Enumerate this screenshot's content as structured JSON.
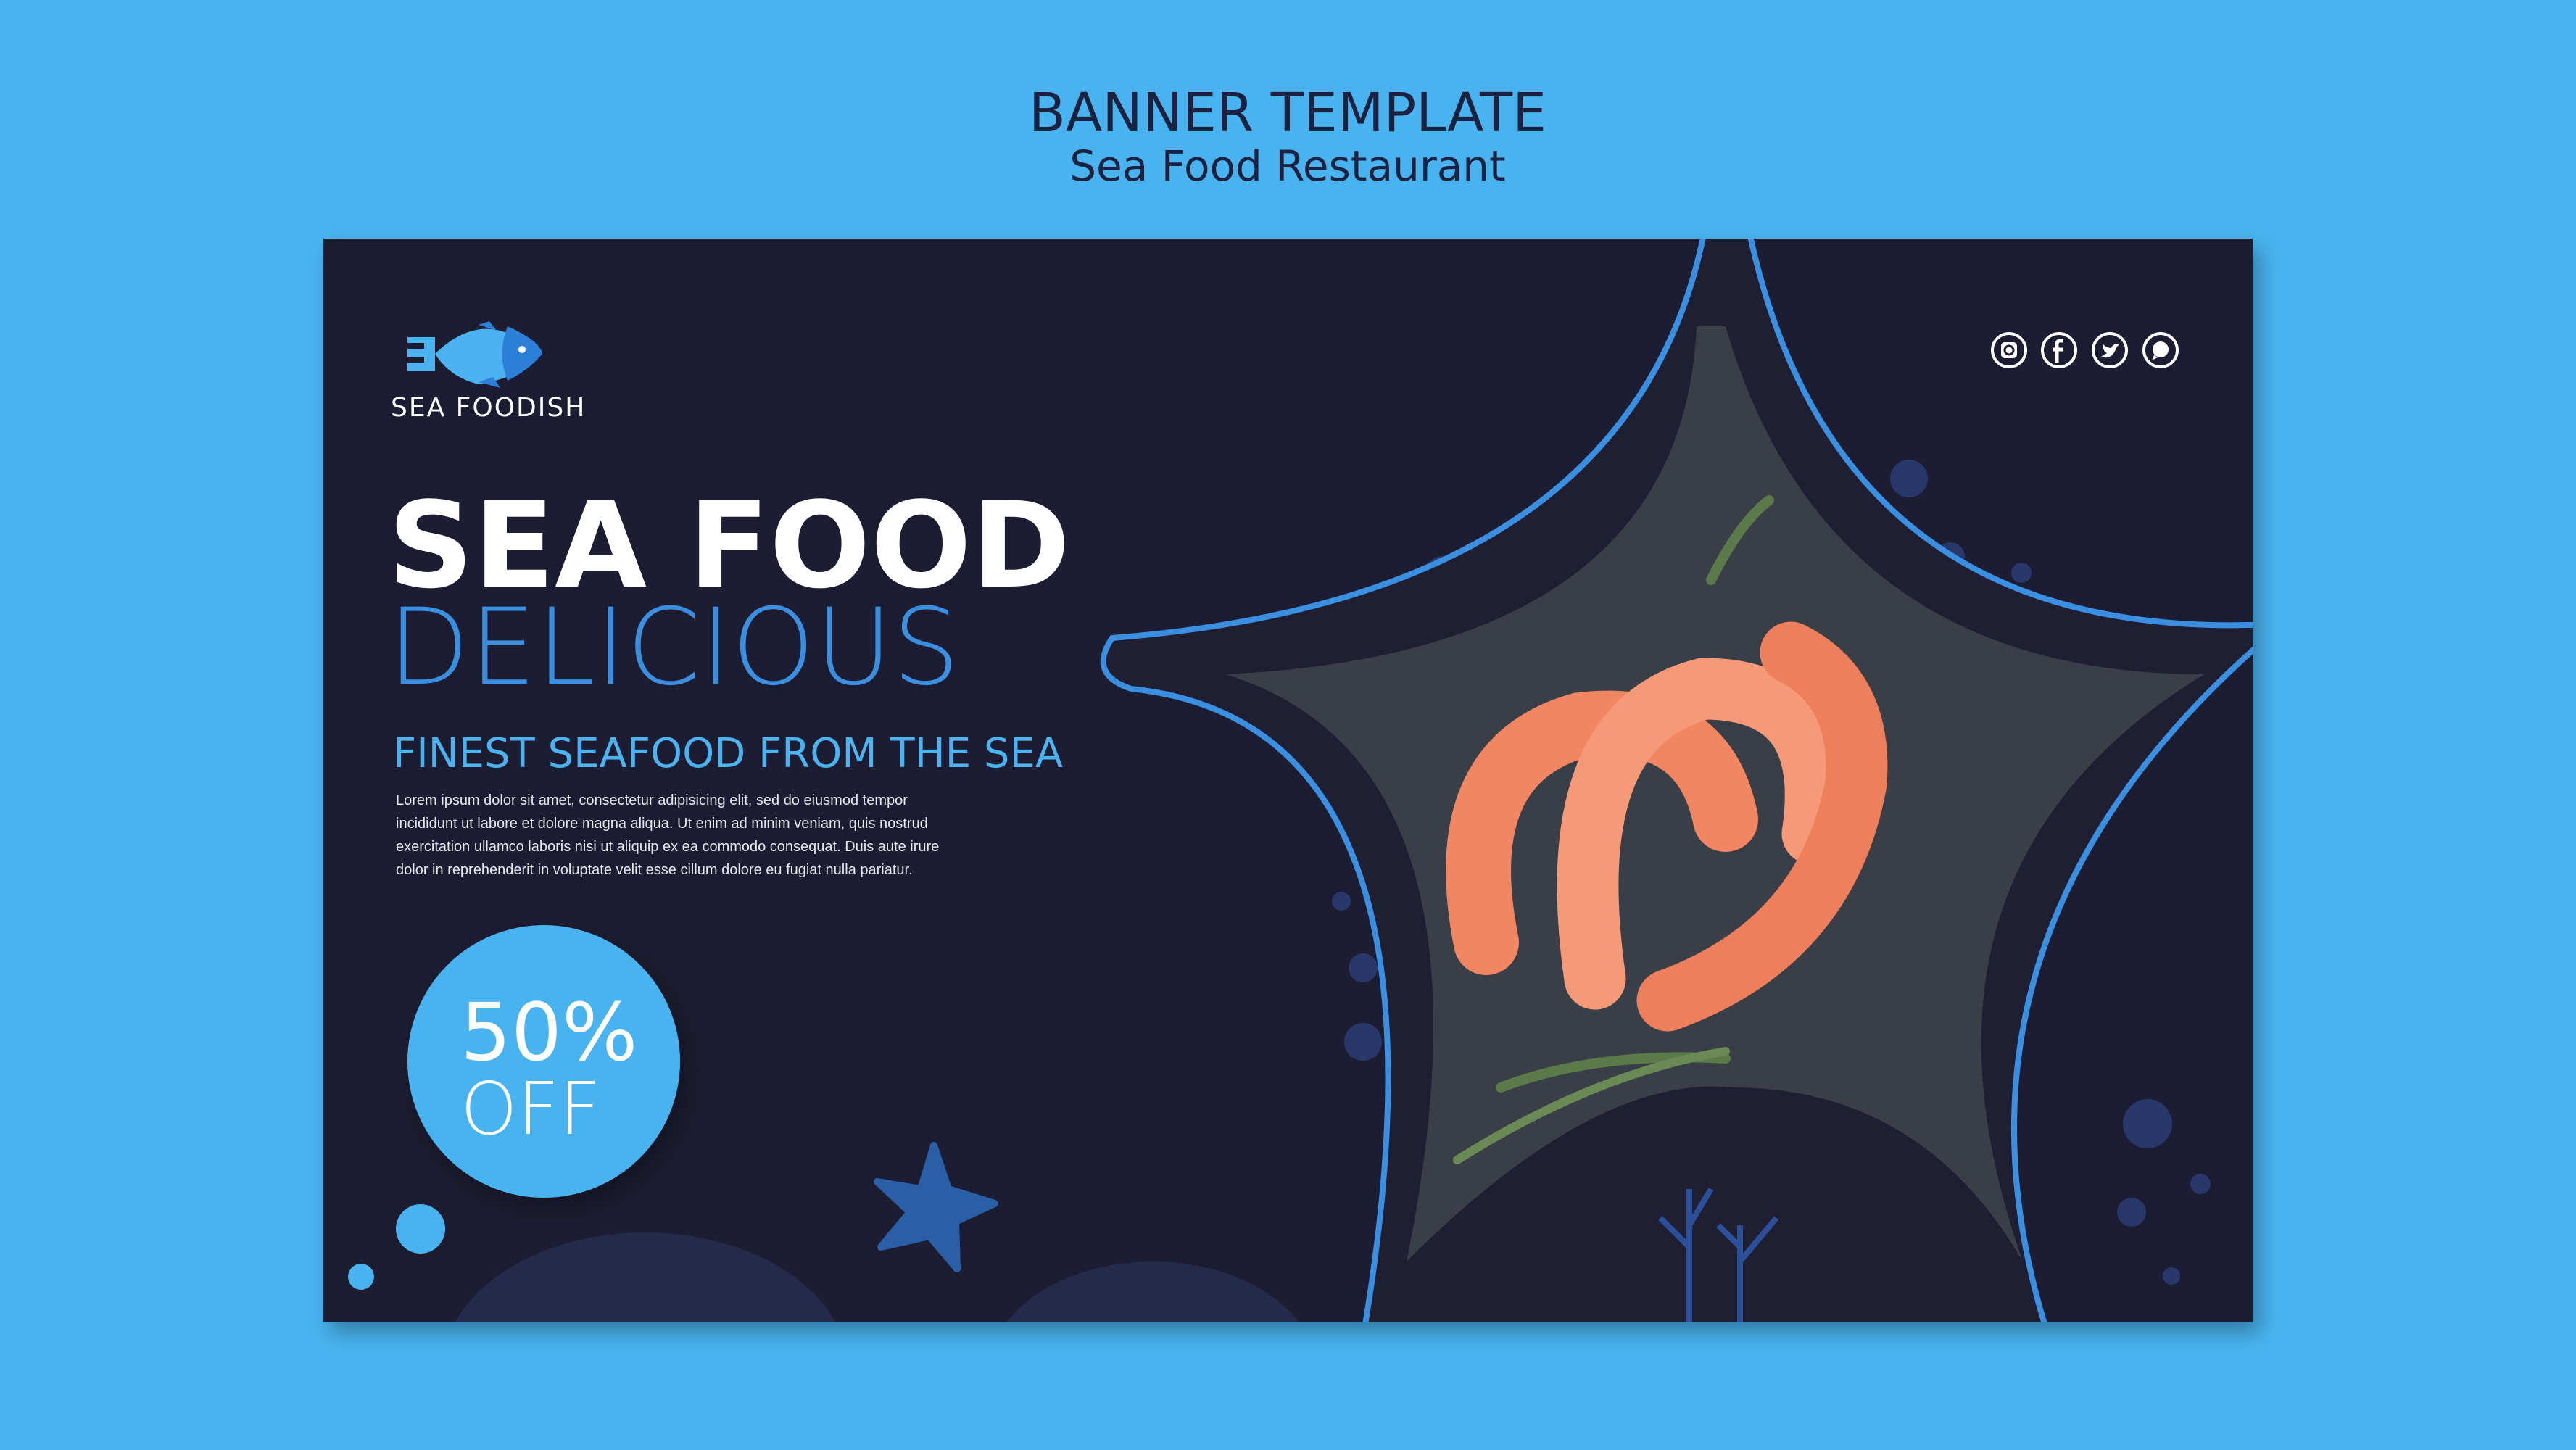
{
  "header": {
    "title": "BANNER TEMPLATE",
    "subtitle": "Sea Food Restaurant"
  },
  "banner": {
    "logo": {
      "text": "SEA FOODISH"
    },
    "headline": "SEA FOOD",
    "subheadline": "DELICIOUS",
    "tagline": "FINEST SEAFOOD FROM THE SEA",
    "body_lines": [
      "Lorem ipsum dolor sit amet, consectetur adipisicing elit, sed do eiusmod tempor",
      "incididunt ut labore et dolore magna aliqua. Ut enim ad minim veniam, quis nostrud",
      "exercitation ullamco laboris nisi ut aliquip ex ea commodo consequat. Duis aute irure",
      "dolor in reprehenderit in voluptate velit esse cillum dolore eu fugiat nulla pariatur."
    ],
    "discount": {
      "value": "50%",
      "label": "OFF"
    },
    "social_icons": [
      "instagram-icon",
      "facebook-icon",
      "twitter-icon",
      "whatsapp-icon"
    ]
  },
  "colors": {
    "background": "#48b3ef",
    "banner": "#1f1e33",
    "accent": "#3a8fe0",
    "light_accent": "#4ab3f0"
  }
}
